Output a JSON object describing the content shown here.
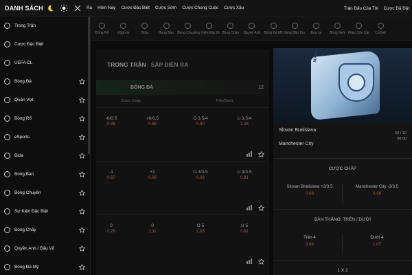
{
  "topbar": {
    "brand": "DANH SÁCH",
    "nav": [
      "Ra",
      "Hôm Nay",
      "Cược Đặc Biệt",
      "Cược Sớm",
      "Cược Chung Cuộc",
      "Cược Xâu"
    ],
    "right": [
      "Trận Đấu Của Tôi",
      "Cược Đã Đặt"
    ]
  },
  "sidebar": {
    "items": [
      {
        "label": "Trong Trận",
        "icon": "live-icon",
        "star": false
      },
      {
        "label": "Cược Đặc Biệt",
        "icon": "special-bet-icon",
        "star": false
      },
      {
        "label": "UEFA CL",
        "icon": "uefa-icon",
        "star": false
      },
      {
        "label": "Bóng Đá",
        "icon": "soccer-icon",
        "star": true
      },
      {
        "label": "Quần Vợt",
        "icon": "tennis-icon",
        "star": true
      },
      {
        "label": "Bóng Rổ",
        "icon": "basketball-icon",
        "star": true
      },
      {
        "label": "eSports",
        "icon": "esports-icon",
        "star": true
      },
      {
        "label": "Bida",
        "icon": "billiards-icon",
        "star": true
      },
      {
        "label": "Bóng Bàn",
        "icon": "table-tennis-icon",
        "star": true
      },
      {
        "label": "Bóng Chuyền",
        "icon": "volleyball-icon",
        "star": true
      },
      {
        "label": "Sự Kiện Đặc Biệt",
        "icon": "special-event-icon",
        "star": true
      },
      {
        "label": "Bóng Chày",
        "icon": "baseball-icon",
        "star": true
      },
      {
        "label": "Quyền Anh / Đấu Võ",
        "icon": "boxing-icon",
        "star": true
      },
      {
        "label": "Bóng Đá Mỹ",
        "icon": "american-football-icon",
        "star": true
      }
    ]
  },
  "sports": [
    "Bóng Rổ",
    "eSports",
    "Bida",
    "Bóng Bàn",
    "Bóng Chuyền",
    "Sự Kiện Đặc Biệt",
    "Bóng Chày",
    "Quyền Anh",
    "Bóng Đá Mỹ",
    "Bóng Bầu Dục",
    "Đua xe",
    "Bóng Ném",
    "Khúc Côn Cầu",
    "Cricket"
  ],
  "main": {
    "tab_active": "TRONG TRẬN",
    "tab_other": "SẮP DIỄN RA",
    "section_title": "BÓNG ĐÁ",
    "section_count": "12",
    "col_handicap": "Cược Chấp",
    "col_overunder": "Trên/Dưới",
    "matches": [
      {
        "odds": [
          {
            "line": "-0/0.5",
            "price": "0.98"
          },
          {
            "line": "+0/0.5",
            "price": "0.88"
          },
          {
            "line": "O 3.5/4",
            "price": "0.80"
          },
          {
            "line": "U 3.5/4",
            "price": "1.08"
          }
        ]
      },
      {
        "odds": [
          {
            "line": "-1",
            "price": "0.87"
          },
          {
            "line": "+1",
            "price": "0.99"
          },
          {
            "line": "O 3/3.5",
            "price": "0.93"
          },
          {
            "line": "U 3/3.5",
            "price": "0.91"
          }
        ]
      },
      {
        "odds": [
          {
            "line": "0",
            "price": "0.76"
          },
          {
            "line": "0",
            "price": "1.11"
          },
          {
            "line": "O 5",
            "price": "1.03"
          },
          {
            "line": "U 5",
            "price": "0.81"
          }
        ]
      }
    ]
  },
  "right": {
    "team1": "Slovan Bratislava",
    "team2": "Manchester City",
    "date": "02 / 10",
    "time": "00:00",
    "flag_text": "MANCHESTER CITY",
    "handicap_title": "CƯỢC CHẤP",
    "handicap": [
      {
        "label": "Slovan Bratislava +3/3.5",
        "price": "0.88"
      },
      {
        "label": "Manchester City -3/3.5",
        "price": "0.98"
      }
    ],
    "ou_title": "BÀN THẮNG: TRÊN / DƯỚI",
    "ou": [
      {
        "label": "Trên 4",
        "price": "0.83"
      },
      {
        "label": "Dưới 4",
        "price": "1.07"
      }
    ],
    "x12_title": "1 X 2"
  }
}
